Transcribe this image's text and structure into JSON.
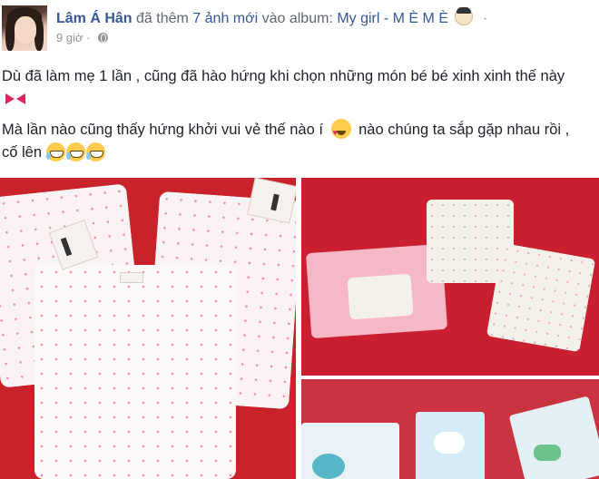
{
  "post": {
    "author": "Lâm Á Hân",
    "action_prefix": "đã thêm",
    "photo_count_link": "7 ảnh mới",
    "action_mid": "vào album:",
    "album_name": "My girl - M È M È",
    "time": "9 giờ",
    "dot_separator": "·",
    "privacy_icon": "globe-icon",
    "paragraph_1": "Dù đã làm mẹ 1 lần , cũng đã hào hứng khi chọn những món bé bé xinh xinh thế này",
    "paragraph_2a": "Mà lần nào cũng thấy hứng khởi vui vẻ thế nào í",
    "paragraph_2b": "nào chúng ta sắp gặp nhau rồi , cố lên",
    "emoji": [
      "ribbon-bow-icon",
      "heart-eyes-icon",
      "grin-sweat-icon"
    ]
  },
  "colors": {
    "link": "#365899",
    "text": "#1d2129",
    "meta": "#90949c",
    "photo_background_red": "#c8232a"
  }
}
